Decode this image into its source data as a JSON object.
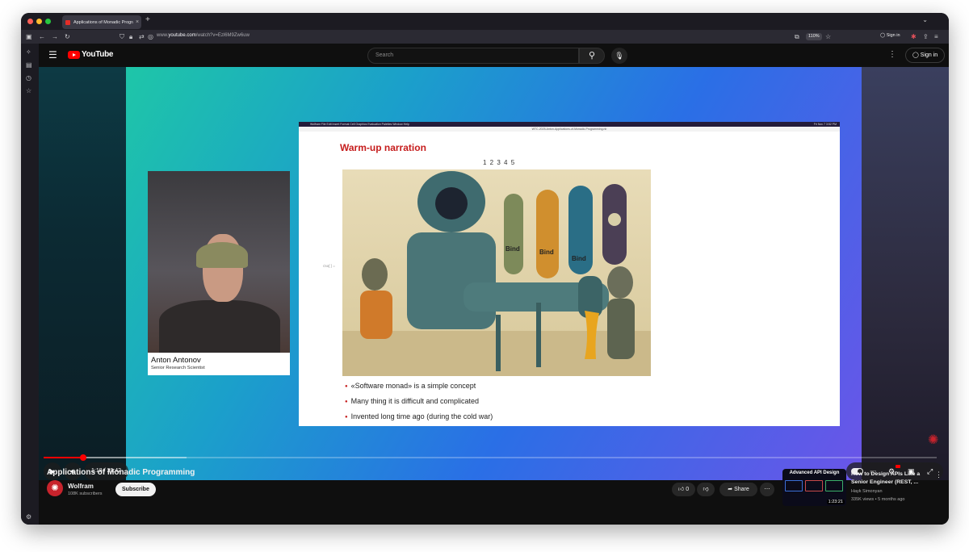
{
  "browser": {
    "tab_title": "Applications of Monadic Progra",
    "tab_close": "×",
    "new_tab": "+",
    "url_prefix": "www.",
    "url_host": "youtube.com",
    "url_path": "/watch?v=Ezl6M9Zw6uw",
    "zoom": "110%",
    "sign_in": "Sign in"
  },
  "youtube": {
    "logo_text": "YouTube",
    "search_placeholder": "Search",
    "sign_in": "Sign in"
  },
  "video": {
    "presenter_name": "Anton Antonov",
    "presenter_title": "Senior Research Scientist",
    "slide": {
      "mac_menu": "Wolfram  File  Edit  Insert  Format  Cell  Graphics  Evaluation  Palettes  Window  Help",
      "mac_clock": "Fri Nov 7  3:52 PM",
      "window_title": "WTC-2025-Anton-Applications-of-Monadic-Programming.nb",
      "heading": "Warm-up narration",
      "pager": "1 2 3 4 5",
      "out_label": "Out[ ] =",
      "bullets": [
        "«Software monad» is a simple concept",
        "Many thing it is difficult and complicated",
        "Invented long time ago (during the cold war)"
      ],
      "bind_labels": [
        "Bind",
        "Bind",
        "Bind"
      ]
    },
    "time": "1:18 / 29:42",
    "progress_fraction": 0.044
  },
  "meta": {
    "title": "Applications of Monadic Programming",
    "channel": "Wolfram",
    "subscribers": "108K subscribers",
    "subscribe_label": "Subscribe",
    "likes": "0",
    "share_label": "Share"
  },
  "recommendation": {
    "thumb_title": "Advanced API Design",
    "duration": "1:23:21",
    "title": "How to Design APIs Like a Senior Engineer (REST, ...",
    "author": "Hayk Simonyan",
    "stats": "335K views • 5 months ago"
  }
}
